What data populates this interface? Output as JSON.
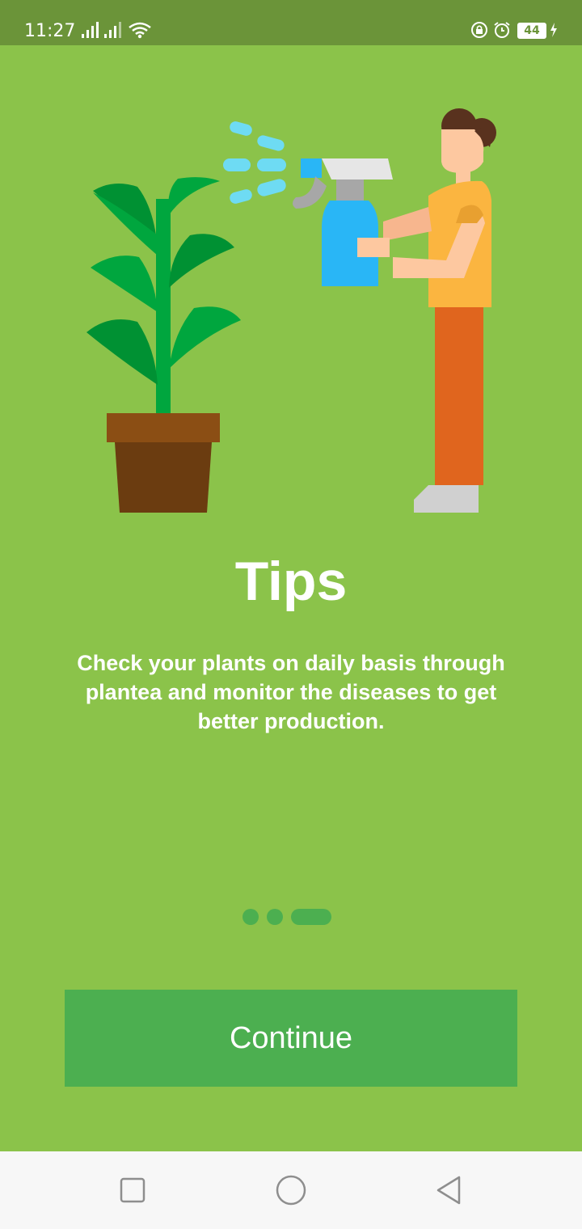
{
  "status_bar": {
    "time": "11:27",
    "battery_level": "44",
    "icons": [
      "signal-icon",
      "signal-icon",
      "wifi-icon",
      "rotation-lock-icon",
      "alarm-icon",
      "battery-icon",
      "charging-icon"
    ]
  },
  "onboarding": {
    "title": "Tips",
    "description": "Check your plants on daily basis through plantea and monitor the diseases to get better production.",
    "page_indicator": {
      "total": 3,
      "current": 3
    },
    "continue_label": "Continue"
  },
  "nav_bar": {
    "icons": [
      "recents-square-icon",
      "home-circle-icon",
      "back-triangle-icon"
    ]
  },
  "colors": {
    "background": "#8BC34A",
    "status_bar": "#6B9439",
    "accent": "#4CAF50",
    "text": "#FFFFFF"
  }
}
